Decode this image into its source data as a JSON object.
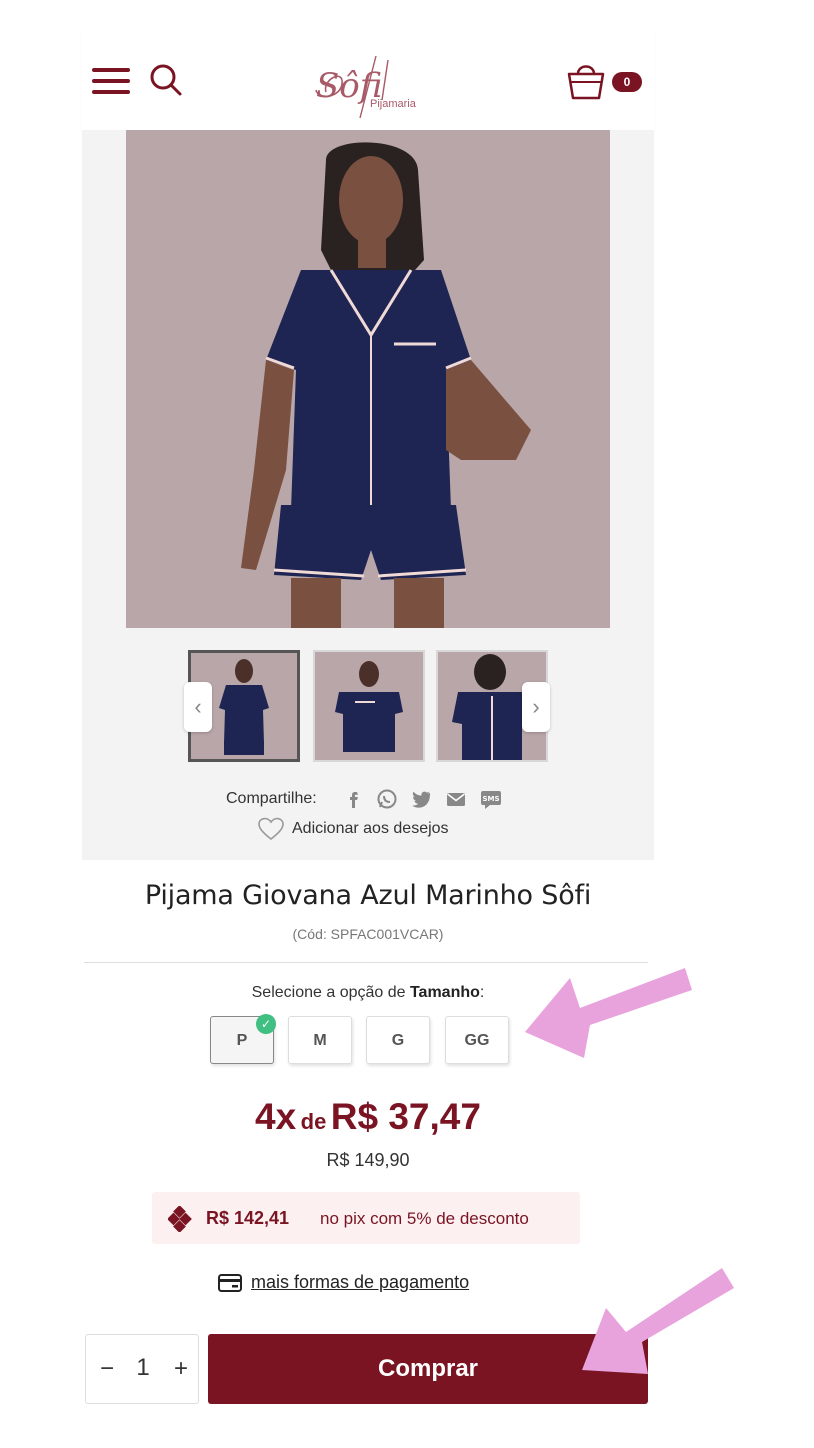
{
  "header": {
    "logo_text": "Sôfi",
    "logo_subtext": "Pijamaria",
    "cart_count": "0"
  },
  "gallery": {
    "share_label": "Compartilhe:",
    "share_icons": [
      "facebook-icon",
      "whatsapp-icon",
      "twitter-icon",
      "email-icon",
      "sms-icon"
    ],
    "sms_text": "SMS",
    "wishlist_label": "Adicionar aos desejos"
  },
  "product": {
    "title": "Pijama Giovana Azul Marinho Sôfi",
    "sku": "(Cód: SPFAC001VCAR)"
  },
  "size": {
    "label_prefix": "Selecione a opção de ",
    "label_bold": "Tamanho",
    "label_suffix": ":",
    "options": [
      "P",
      "M",
      "G",
      "GG"
    ],
    "selected": "P"
  },
  "price": {
    "installments": "4x",
    "de": "de",
    "installment_value": "R$ 37,47",
    "full": "R$ 149,90"
  },
  "pix": {
    "value": "R$ 142,41",
    "text": "no pix com 5% de desconto"
  },
  "payment_link": "mais formas de pagamento",
  "quantity": {
    "minus": "−",
    "value": "1",
    "plus": "+"
  },
  "buy_label": "Comprar",
  "colors": {
    "brand": "#7a1422",
    "annotation_arrow": "#e8a3dc",
    "pix_bg": "#fcf0f1",
    "check": "#3fbf82"
  }
}
